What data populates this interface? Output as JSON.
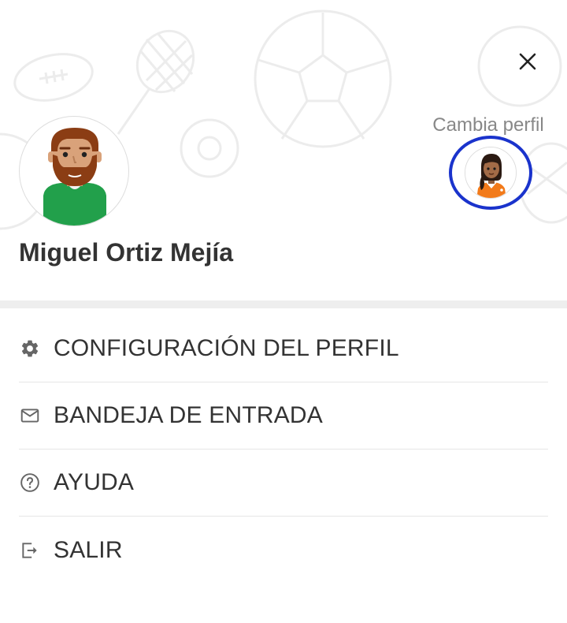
{
  "profile": {
    "name": "Miguel Ortiz Mejía",
    "switch_label": "Cambia perfil"
  },
  "menu": {
    "items": [
      {
        "label": "CONFIGURACIÓN DEL PERFIL",
        "icon": "gear-icon"
      },
      {
        "label": "BANDEJA DE ENTRADA",
        "icon": "envelope-icon"
      },
      {
        "label": "AYUDA",
        "icon": "help-circle-icon"
      },
      {
        "label": "SALIR",
        "icon": "logout-icon"
      }
    ]
  },
  "icons": {
    "close": "close-icon"
  },
  "colors": {
    "highlight_ring": "#1a33cc",
    "text": "#333333",
    "muted_text": "#888888",
    "divider": "#eeeeee",
    "shirt_green": "#22a04b",
    "jersey_orange": "#f27a1a"
  }
}
